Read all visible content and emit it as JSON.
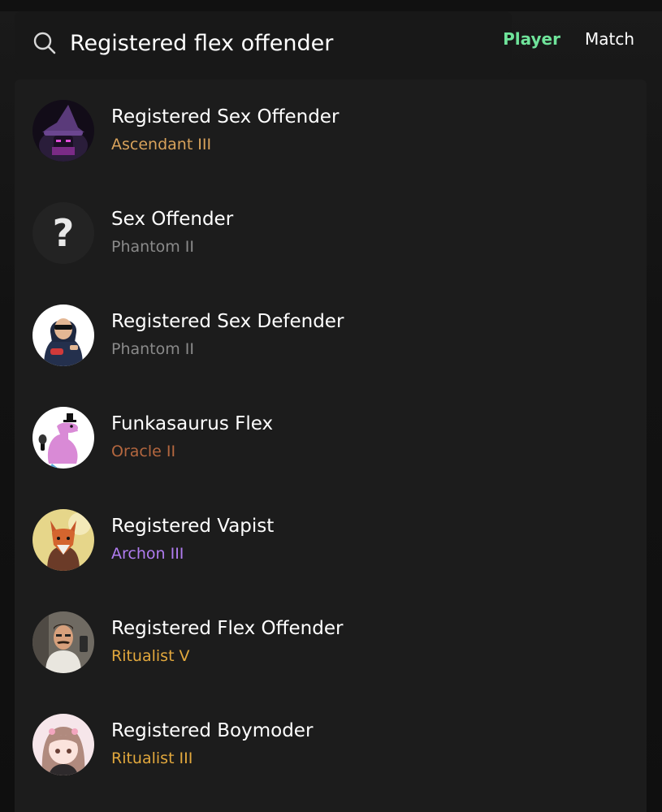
{
  "search": {
    "value": "Registered flex offender",
    "placeholder": ""
  },
  "tabs": [
    {
      "label": "Player",
      "active": true
    },
    {
      "label": "Match",
      "active": false
    }
  ],
  "colors": {
    "active_tab": "#6fe39a",
    "ascendant": "#d8a25b",
    "phantom": "#8a8a8a",
    "oracle": "#b4673f",
    "archon": "#b07cf0",
    "ritualist": "#e2a83d"
  },
  "results": [
    {
      "name": "Registered Sex Offender",
      "rank": "Ascendant III",
      "rank_color": "#d8a25b",
      "avatar": "wizard-avatar"
    },
    {
      "name": "Sex Offender",
      "rank": "Phantom II",
      "rank_color": "#8a8a8a",
      "avatar": "unknown-avatar"
    },
    {
      "name": "Registered Sex Defender",
      "rank": "Phantom II",
      "rank_color": "#8a8a8a",
      "avatar": "hooded-man-avatar"
    },
    {
      "name": "Funkasaurus Flex",
      "rank": "Oracle II",
      "rank_color": "#b4673f",
      "avatar": "dinosaur-avatar"
    },
    {
      "name": "Registered Vapist",
      "rank": "Archon III",
      "rank_color": "#b07cf0",
      "avatar": "fox-avatar"
    },
    {
      "name": "Registered Flex Offender",
      "rank": "Ritualist V",
      "rank_color": "#e2a83d",
      "avatar": "mustache-man-avatar"
    },
    {
      "name": "Registered Boymoder",
      "rank": "Ritualist III",
      "rank_color": "#e2a83d",
      "avatar": "anime-girl-avatar"
    }
  ]
}
